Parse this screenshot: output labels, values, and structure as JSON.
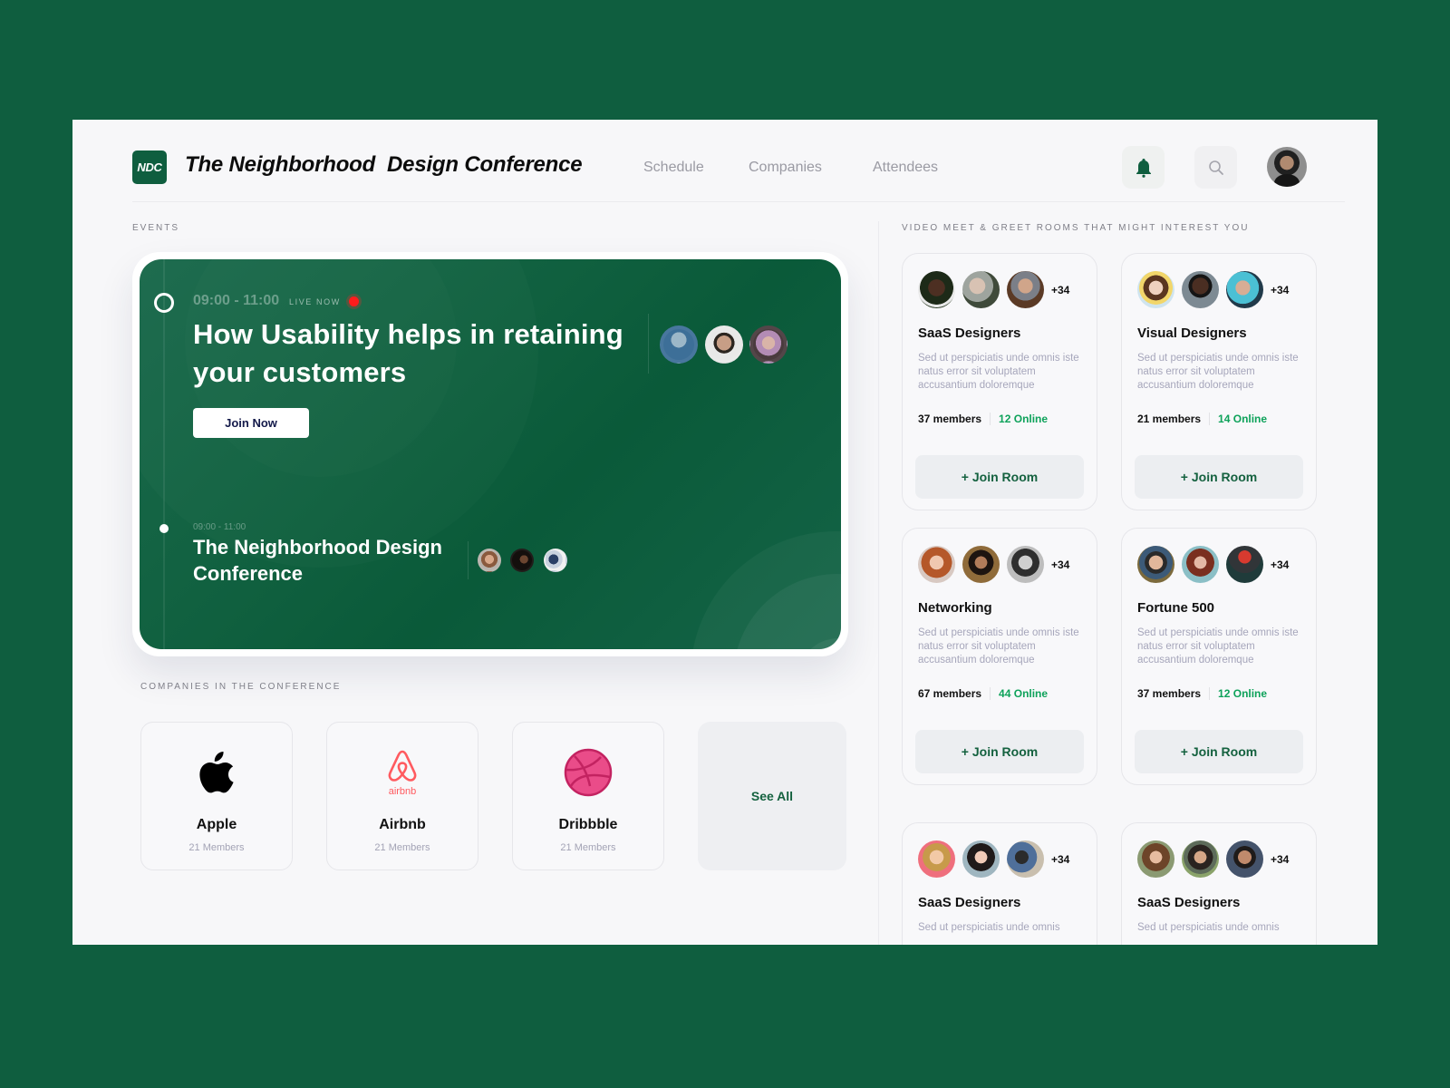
{
  "header": {
    "logo_text": "NDC",
    "title": "The Neighborhood  Design Conference",
    "nav": [
      "Schedule",
      "Companies",
      "Attendees"
    ],
    "accent_color": "#0f5e3f"
  },
  "events": {
    "section_label": "EVENTS",
    "live": {
      "time": "09:00 - 11:00",
      "status": "LIVE NOW",
      "title": "How Usability helps in retaining your customers",
      "cta": "Join Now",
      "attendee_count_shown": 3
    },
    "upcoming": {
      "time": "09:00 - 11:00",
      "title": "The Neighborhood  Design\nConference",
      "attendee_count_shown": 3
    }
  },
  "companies": {
    "section_label": "COMPANIES IN THE CONFERENCE",
    "items": [
      {
        "name": "Apple",
        "members": "21 Members",
        "icon": "apple-logo"
      },
      {
        "name": "Airbnb",
        "members": "21 Members",
        "icon": "airbnb-logo"
      },
      {
        "name": "Dribbble",
        "members": "21 Members",
        "icon": "dribbble-logo"
      }
    ],
    "see_all": "See All"
  },
  "rooms": {
    "section_label": "VIDEO MEET & GREET ROOMS THAT MIGHT INTEREST YOU",
    "items": [
      {
        "name": "SaaS Designers",
        "description": "Sed ut perspiciatis unde omnis iste natus error sit voluptatem accusantium doloremque",
        "members": "37 members",
        "online": "12 Online",
        "extra": "+34",
        "join": "+ Join Room"
      },
      {
        "name": "Visual Designers",
        "description": "Sed ut perspiciatis unde omnis iste natus error sit voluptatem accusantium doloremque",
        "members": "21 members",
        "online": "14 Online",
        "extra": "+34",
        "join": "+ Join Room"
      },
      {
        "name": "Networking",
        "description": "Sed ut perspiciatis unde omnis iste natus error sit voluptatem accusantium doloremque",
        "members": "67 members",
        "online": "44 Online",
        "extra": "+34",
        "join": "+ Join Room"
      },
      {
        "name": "Fortune 500",
        "description": "Sed ut perspiciatis unde omnis iste natus error sit voluptatem accusantium doloremque",
        "members": "37 members",
        "online": "12 Online",
        "extra": "+34",
        "join": "+ Join Room"
      },
      {
        "name": "SaaS Designers",
        "description": "Sed ut perspiciatis unde omnis",
        "extra": "+34"
      },
      {
        "name": "SaaS Designers",
        "description": "Sed ut perspiciatis unde omnis",
        "extra": "+34"
      }
    ]
  }
}
